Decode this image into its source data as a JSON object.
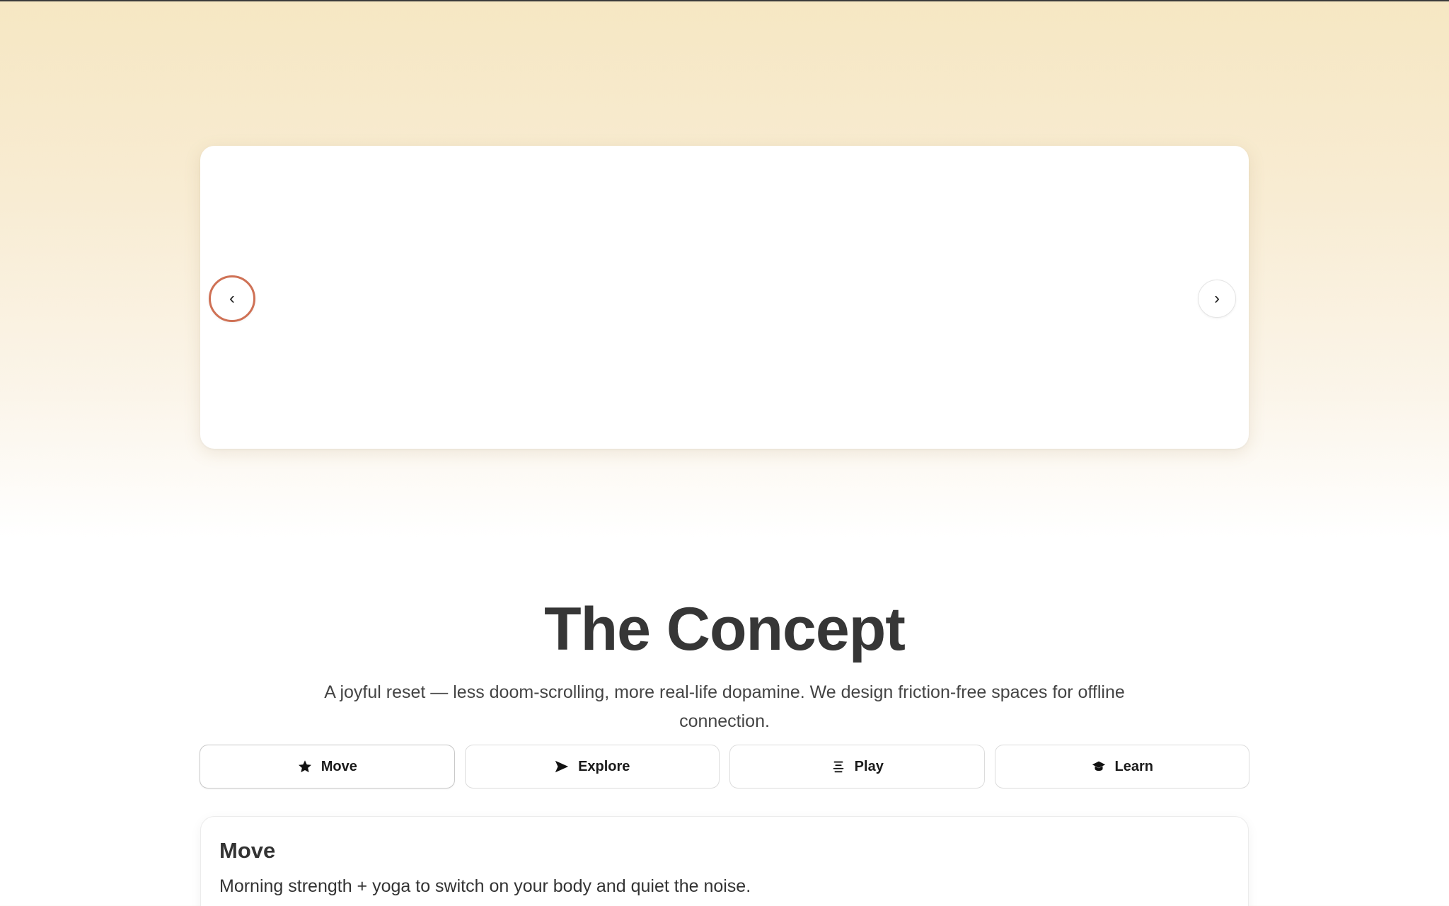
{
  "carousel": {
    "prev_glyph": "‹",
    "next_glyph": "›"
  },
  "concept": {
    "title": "The Concept",
    "description": "A joyful reset — less doom-scrolling, more real-life dopamine. We design friction-free spaces for offline connection."
  },
  "tabs": [
    {
      "label": "Move",
      "icon": "star-icon",
      "active": true
    },
    {
      "label": "Explore",
      "icon": "send-icon",
      "active": false
    },
    {
      "label": "Play",
      "icon": "align-center-icon",
      "active": false
    },
    {
      "label": "Learn",
      "icon": "graduation-cap-icon",
      "active": false
    }
  ],
  "panel": {
    "title": "Move",
    "text": "Morning strength + yoga to switch on your body and quiet the noise."
  },
  "colors": {
    "accent_ring": "#cf7155",
    "heading": "#363636",
    "background_top": "#f6e7c3"
  }
}
